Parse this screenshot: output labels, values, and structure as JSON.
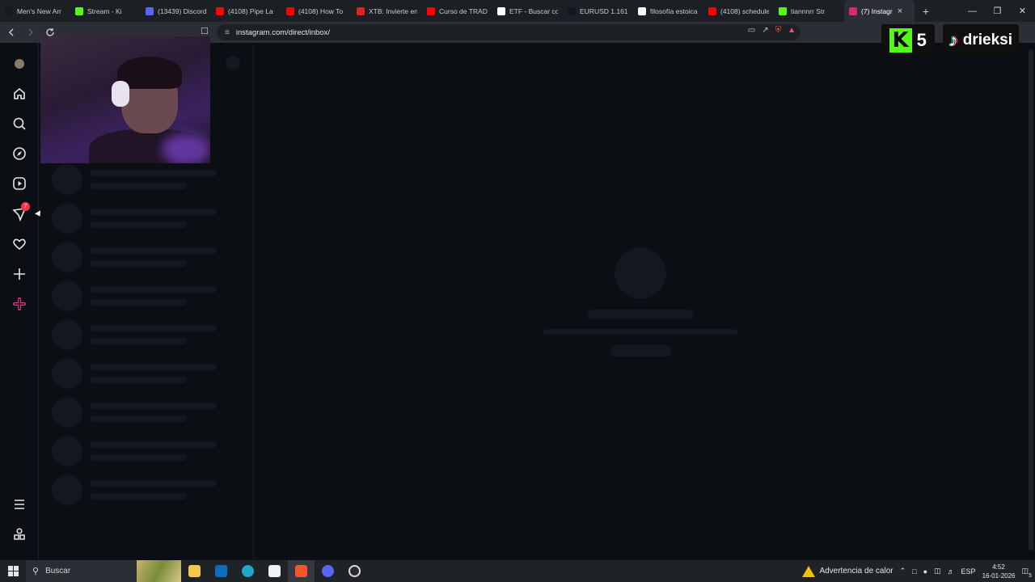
{
  "tabs": [
    {
      "title": "Men's New Arr",
      "fav_color": "#1a1a1a"
    },
    {
      "title": "Stream - Ki",
      "fav_color": "#53fc18"
    },
    {
      "title": "(13439) Discord",
      "fav_color": "#5865f2"
    },
    {
      "title": "(4108) Pipe La",
      "fav_color": "#ff0000"
    },
    {
      "title": "(4108) How To",
      "fav_color": "#ff0000"
    },
    {
      "title": "XTB: Invierte en",
      "fav_color": "#e2231a"
    },
    {
      "title": "Curso de TRAD",
      "fav_color": "#ff0000"
    },
    {
      "title": "ETF - Buscar co",
      "fav_color": "#ffffff"
    },
    {
      "title": "EURUSD 1.161",
      "fav_color": "#131722"
    },
    {
      "title": "filosofía estoica",
      "fav_color": "#ffffff"
    },
    {
      "title": "(4108) schedule",
      "fav_color": "#ff0000"
    },
    {
      "title": "tiannnrr Str",
      "fav_color": "#53fc18"
    },
    {
      "title": "(7) Instagr",
      "fav_color": "#d62976",
      "active": true
    }
  ],
  "toolbar": {
    "url": "instagram.com/direct/inbox/"
  },
  "overlay": {
    "kick_count": "5",
    "tiktok_name": "drieksi"
  },
  "ig": {
    "notification_count": "7"
  },
  "taskbar": {
    "search_placeholder": "Buscar",
    "warning_text": "Advertencia de calor",
    "language": "ESP",
    "time": "4:52",
    "date": "16-01-2026",
    "notif_count": "5"
  }
}
